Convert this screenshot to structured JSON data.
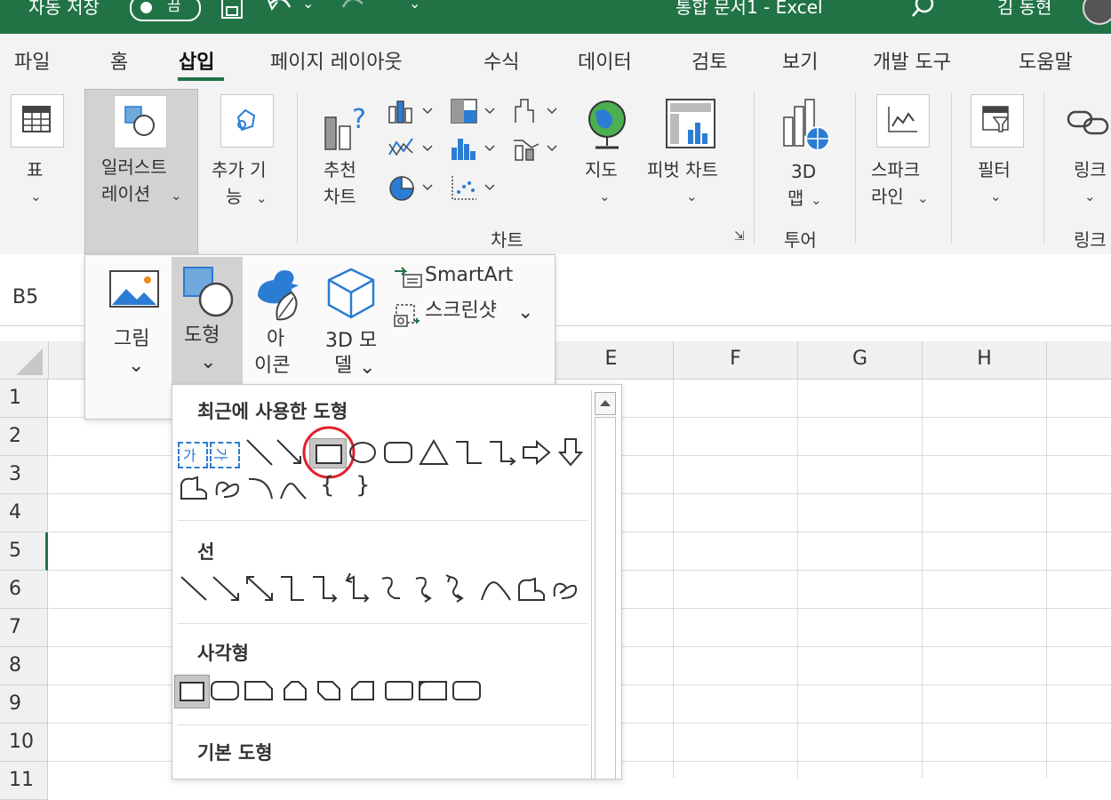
{
  "titlebar": {
    "autosave": "자동 저장",
    "toggle": "끔",
    "doc_title": "통합 문서1  -  Excel",
    "user": "김 동현"
  },
  "tabs": [
    "파일",
    "홈",
    "삽입",
    "페이지 레이아웃",
    "수식",
    "데이터",
    "검토",
    "보기",
    "개발 도구",
    "도움말"
  ],
  "active_tab": "삽입",
  "ribbon": {
    "table": "표",
    "illustrations_1": "일러스트",
    "illustrations_2": "레이션",
    "addins_1": "추가 기",
    "addins_2": "능",
    "rec_charts_1": "추천",
    "rec_charts_2": "차트",
    "maps": "지도",
    "pivot_chart": "피벗 차트",
    "map3d_1": "3D",
    "map3d_2": "맵",
    "sparklines_1": "스파크",
    "sparklines_2": "라인",
    "filters": "필터",
    "link": "링크",
    "group_charts": "차트",
    "group_tours": "투어",
    "group_links": "링크"
  },
  "namebox": "B5",
  "columns": [
    "E",
    "F",
    "G",
    "H"
  ],
  "rows": [
    "1",
    "2",
    "3",
    "4",
    "5",
    "6",
    "7",
    "8",
    "9",
    "10",
    "11"
  ],
  "illustrations_menu": {
    "pictures": "그림",
    "shapes": "도형",
    "icons_1": "아",
    "icons_2": "이콘",
    "models_1": "3D 모",
    "models_2": "델",
    "smartart": "SmartArt",
    "screenshot": "스크린샷"
  },
  "shapes_gallery": {
    "recent": "최근에 사용한 도형",
    "lines": "선",
    "rectangles": "사각형",
    "basic": "기본 도형",
    "textbox_h": "가",
    "textbox_v": "가"
  },
  "colors": {
    "excel_green": "#217346",
    "highlight_red": "#e0202a",
    "icon_blue": "#2b7cd3"
  }
}
